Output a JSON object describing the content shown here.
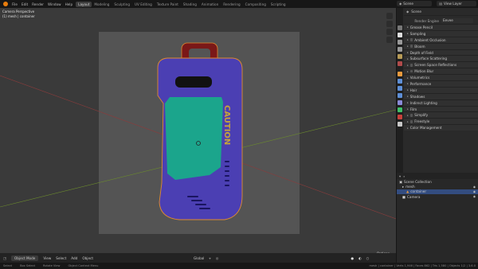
{
  "menu": {
    "items": [
      "File",
      "Edit",
      "Render",
      "Window",
      "Help"
    ]
  },
  "workspaces": {
    "tabs": [
      "Layout",
      "Modeling",
      "Sculpting",
      "UV Editing",
      "Texture Paint",
      "Shading",
      "Animation",
      "Rendering",
      "Compositing",
      "Scripting"
    ],
    "active": "Layout"
  },
  "scene_selector": {
    "label": "Scene"
  },
  "layer_selector": {
    "label": "View Layer"
  },
  "viewport": {
    "camera_label": "Camera Perspective",
    "object_label": "(1) mesh | container",
    "options_label": "Options",
    "caution_text": "CAUTION"
  },
  "header_bottom": {
    "mode": "Object Mode",
    "menus": [
      "View",
      "Select",
      "Add",
      "Object"
    ],
    "transform": "Global"
  },
  "properties": {
    "breadcrumb": "Scene",
    "render_engine_label": "Render Engine",
    "render_engine_value": "Eevee",
    "panels": [
      {
        "label": "Grease Pencil",
        "type": "plain"
      },
      {
        "label": "Sampling",
        "type": "plain"
      },
      {
        "label": "Ambient Occlusion",
        "type": "check"
      },
      {
        "label": "Bloom",
        "type": "check"
      },
      {
        "label": "Depth of Field",
        "type": "plain"
      },
      {
        "label": "Subsurface Scattering",
        "type": "plain"
      },
      {
        "label": "Screen Space Reflections",
        "type": "check"
      },
      {
        "label": "Motion Blur",
        "type": "check"
      },
      {
        "label": "Volumetrics",
        "type": "plain"
      },
      {
        "label": "Performance",
        "type": "plain"
      },
      {
        "label": "Hair",
        "type": "plain"
      },
      {
        "label": "Shadows",
        "type": "plain"
      },
      {
        "label": "Indirect Lighting",
        "type": "plain"
      },
      {
        "label": "Film",
        "type": "plain"
      },
      {
        "label": "Simplify",
        "type": "check"
      },
      {
        "label": "Freestyle",
        "type": "check"
      },
      {
        "label": "Color Management",
        "type": "plain"
      }
    ]
  },
  "outliner": {
    "root": "Scene Collection",
    "items": [
      {
        "label": "mesh",
        "level": 1,
        "selected": false
      },
      {
        "label": "container",
        "level": 2,
        "selected": true
      },
      {
        "label": "Camera",
        "level": 1,
        "selected": false
      }
    ]
  },
  "statusbar": {
    "select": "Select",
    "box_select": "Box Select",
    "rotate_view": "Rotate View",
    "context_menu": "Object Context Menu",
    "stats": "mesh | container | Verts 1,946 | Faces 862 | Tris 1,580 | Objects 1/2 | 3.6.0"
  },
  "colors": {
    "accent": "#e87d0d",
    "selection": "#334d80",
    "body": "#4b3fb3",
    "glass": "#1ba58c",
    "handle": "#7a1818",
    "caution": "#c6a43a"
  }
}
